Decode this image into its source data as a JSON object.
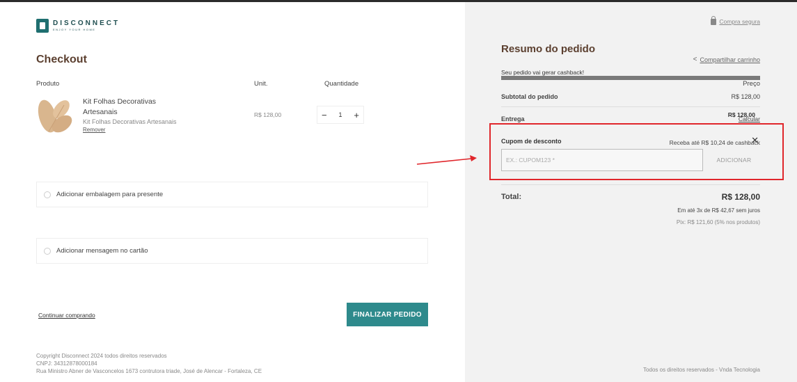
{
  "brand": {
    "name": "DISCONNECT",
    "tagline": "ENJOY YOUR HOME"
  },
  "checkout": {
    "title": "Checkout",
    "share_label": "Compartilhar carrinho",
    "columns": {
      "product": "Produto",
      "unit": "Unit.",
      "quantity": "Quantidade",
      "price": "Preço"
    },
    "item": {
      "name": "Kit Folhas Decorativas Artesanais",
      "variant": "Kit Folhas Decorativas Artesanais",
      "remove_label": "Remover",
      "unit_price": "R$ 128,00",
      "quantity": "1",
      "price": "R$ 128,00"
    },
    "cashback_note": "Receba até R$ 10,24 de cashback",
    "options": [
      {
        "label": "Adicionar embalagem para presente"
      },
      {
        "label": "Adicionar mensagem no cartão"
      }
    ],
    "continue_label": "Continuar comprando",
    "finalize_label": "FINALIZAR PEDIDO",
    "footer": {
      "line1": "Copyright Disconnect 2024 todos direitos reservados",
      "line2": "CNPJ: 34312878000184",
      "line3": "Rua Ministro Abner de Vasconcelos 1673 contrutora triade, José de Alencar - Fortaleza, CE"
    }
  },
  "summary": {
    "secure_label": "Compra segura",
    "title": "Resumo do pedido",
    "cashback_label": "Seu pedido vai gerar cashback!",
    "subtotal_label": "Subtotal do pedido",
    "subtotal_value": "R$ 128,00",
    "shipping_label": "Entrega",
    "shipping_action": "Calcular",
    "coupon_label": "Cupom de desconto",
    "coupon_placeholder": "EX.: CUPOM123 *",
    "coupon_button": "ADICIONAR",
    "total_label": "Total:",
    "total_value": "R$ 128,00",
    "installments": "Em até 3x de R$ 42,67 sem juros",
    "pix": "Pix: R$ 121,60 (5% nos produtos)",
    "footer": "Todos os direitos reservados - Vnda Tecnologia"
  },
  "colors": {
    "accent": "#2e8a8c",
    "title": "#5c4030",
    "annotation": "#e0262b"
  }
}
